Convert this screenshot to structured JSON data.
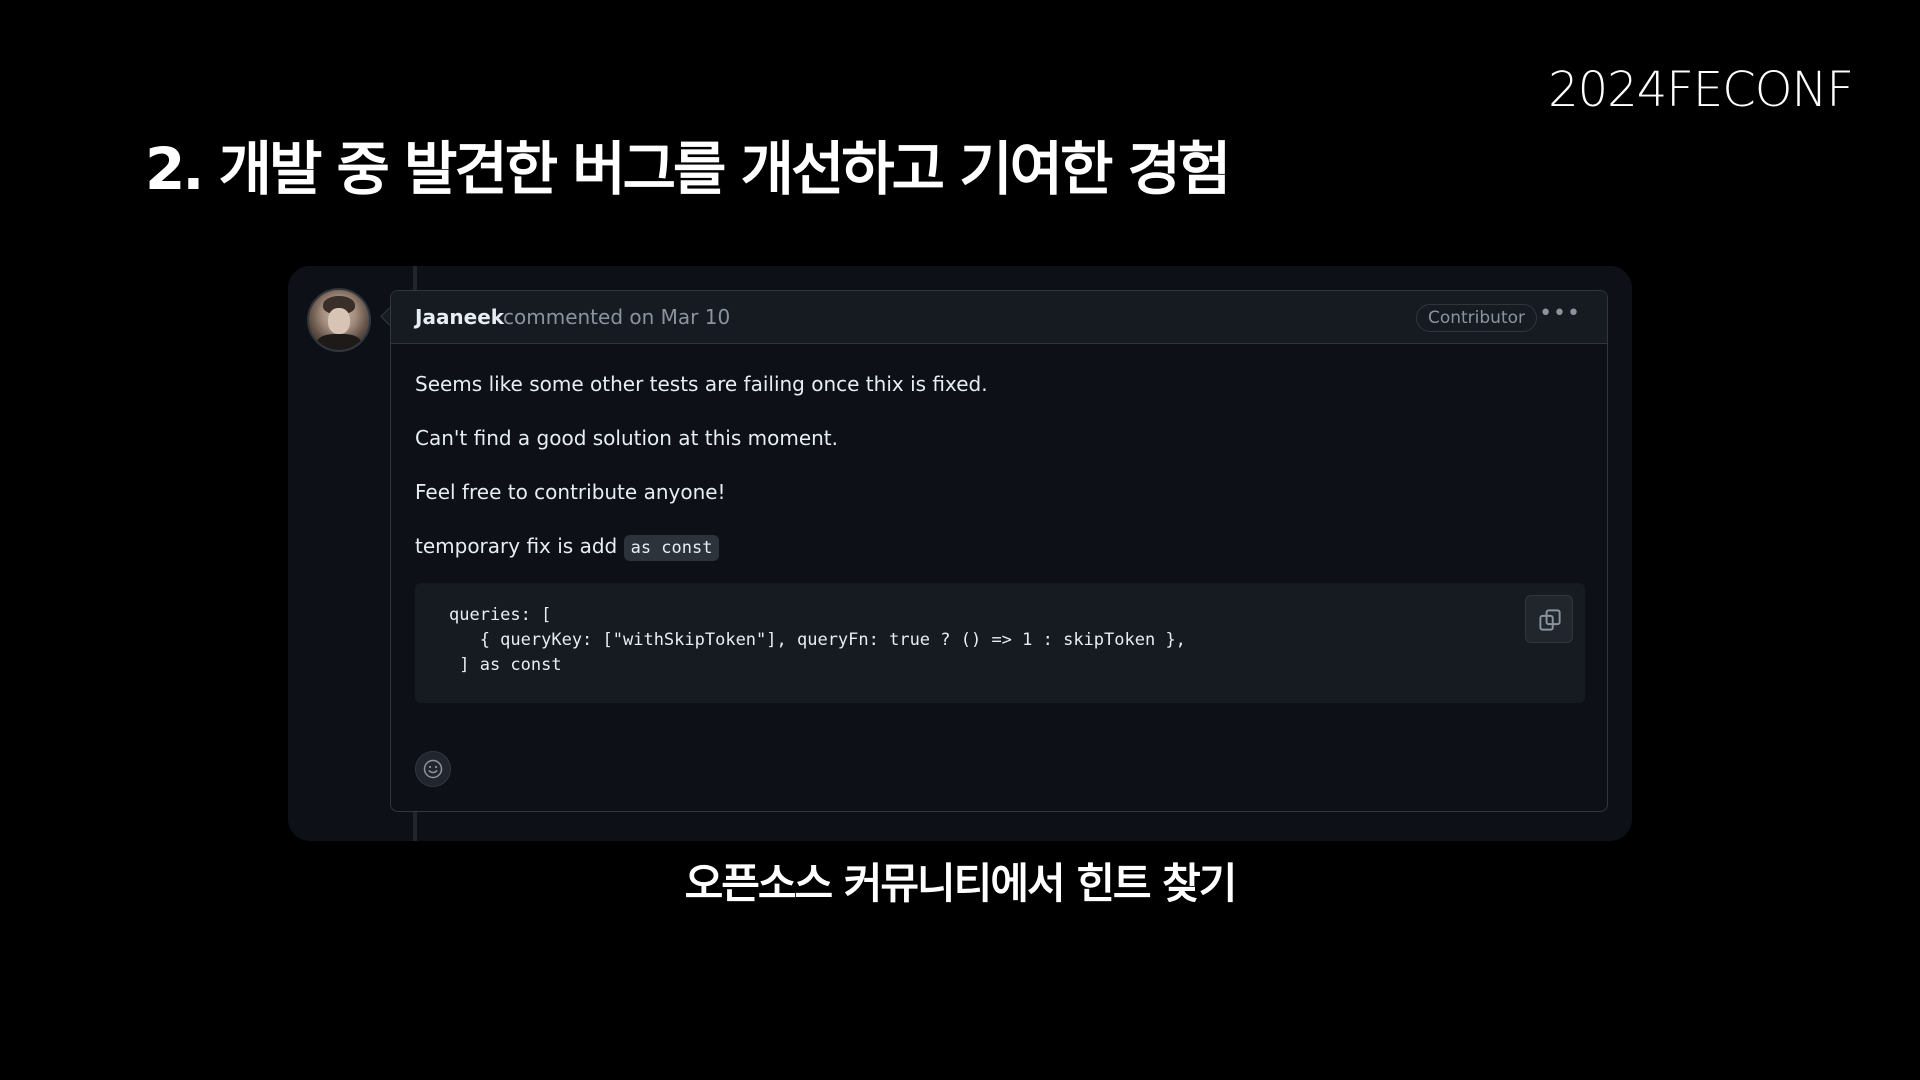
{
  "slide": {
    "brand": "2024FECONF",
    "title": "2. 개발 중 발견한 버그를 개선하고 기여한 경험",
    "caption": "오픈소스 커뮤니티에서 힌트 찾기"
  },
  "comment": {
    "author": "Jaaneek",
    "meta": "commented on Mar 10",
    "badge": "Contributor",
    "more_icon": "kebab-horizontal-icon",
    "paragraphs": [
      "Seems like some other tests are failing once thix is fixed.",
      "Can't find a good solution at this moment.",
      "Feel free to contribute anyone!"
    ],
    "fix_text": "temporary fix is add",
    "fix_code": "as const",
    "code_block": "queries: [\n   { queryKey: [\"withSkipToken\"], queryFn: true ? () => 1 : skipToken },\n ] as const",
    "copy_icon": "copy-icon",
    "reaction_icon": "smiley-icon"
  },
  "colors": {
    "page_bg": "#000000",
    "panel_bg": "#0d1117",
    "header_bg": "#161b22",
    "border": "#30363d",
    "text_primary": "#e6edf3",
    "text_muted": "#8b949e"
  }
}
